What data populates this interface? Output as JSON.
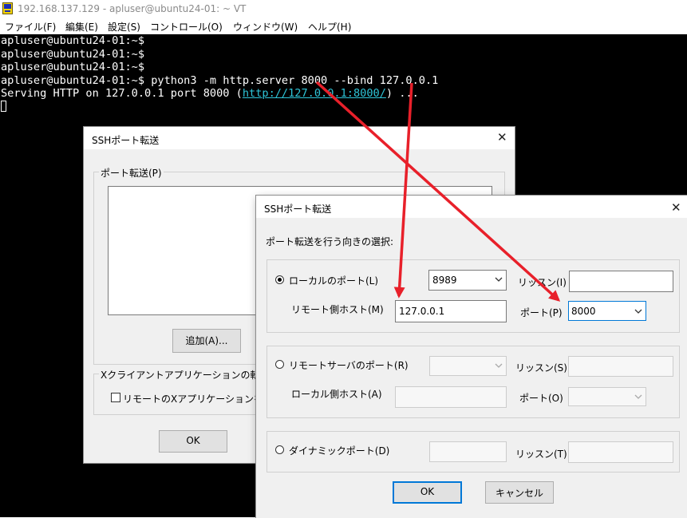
{
  "window": {
    "title": "192.168.137.129 - apluser@ubuntu24-01: ~ VT",
    "icon": "teraterm-app-icon"
  },
  "menu": {
    "items": [
      "ファイル(F)",
      "編集(E)",
      "設定(S)",
      "コントロール(O)",
      "ウィンドウ(W)",
      "ヘルプ(H)"
    ]
  },
  "terminal": {
    "lines": [
      "apluser@ubuntu24-01:~$",
      "apluser@ubuntu24-01:~$",
      "apluser@ubuntu24-01:~$",
      "apluser@ubuntu24-01:~$ python3 -m http.server 8000 --bind 127.0.0.1"
    ],
    "serving_prefix": "Serving HTTP on 127.0.0.1 port 8000 (",
    "serving_url": "http://127.0.0.1:8000/",
    "serving_suffix": ") ..."
  },
  "back_dialog": {
    "title": "SSHポート転送",
    "forwarding_group": "ポート転送(P)",
    "add_button": "追加(A)...",
    "x_group": "Xクライアントアプリケーションの転",
    "x_checkbox": "リモートのXアプリケーションを",
    "ok_button": "OK"
  },
  "front_dialog": {
    "title": "SSHポート転送",
    "direction_label": "ポート転送を行う向きの選択:",
    "local": {
      "radio_label": "ローカルのポート(L)",
      "port_value": "8989",
      "listen_label": "リッスン(I)",
      "listen_value": "",
      "remote_host_label": "リモート側ホスト(M)",
      "remote_host_value": "127.0.0.1",
      "port_label": "ポート(P)",
      "remote_port_value": "8000"
    },
    "remote": {
      "radio_label": "リモートサーバのポート(R)",
      "listen_label": "リッスン(S)",
      "local_host_label": "ローカル側ホスト(A)",
      "port_label": "ポート(O)"
    },
    "dynamic": {
      "radio_label": "ダイナミックポート(D)",
      "listen_label": "リッスン(T)"
    },
    "ok_button": "OK",
    "cancel_button": "キャンセル"
  },
  "colors": {
    "terminal_bg": "#000000",
    "terminal_fg": "#ffffff",
    "url": "#2ec5d8",
    "annotation_arrow": "#e8202a",
    "focus": "#0078d7"
  }
}
